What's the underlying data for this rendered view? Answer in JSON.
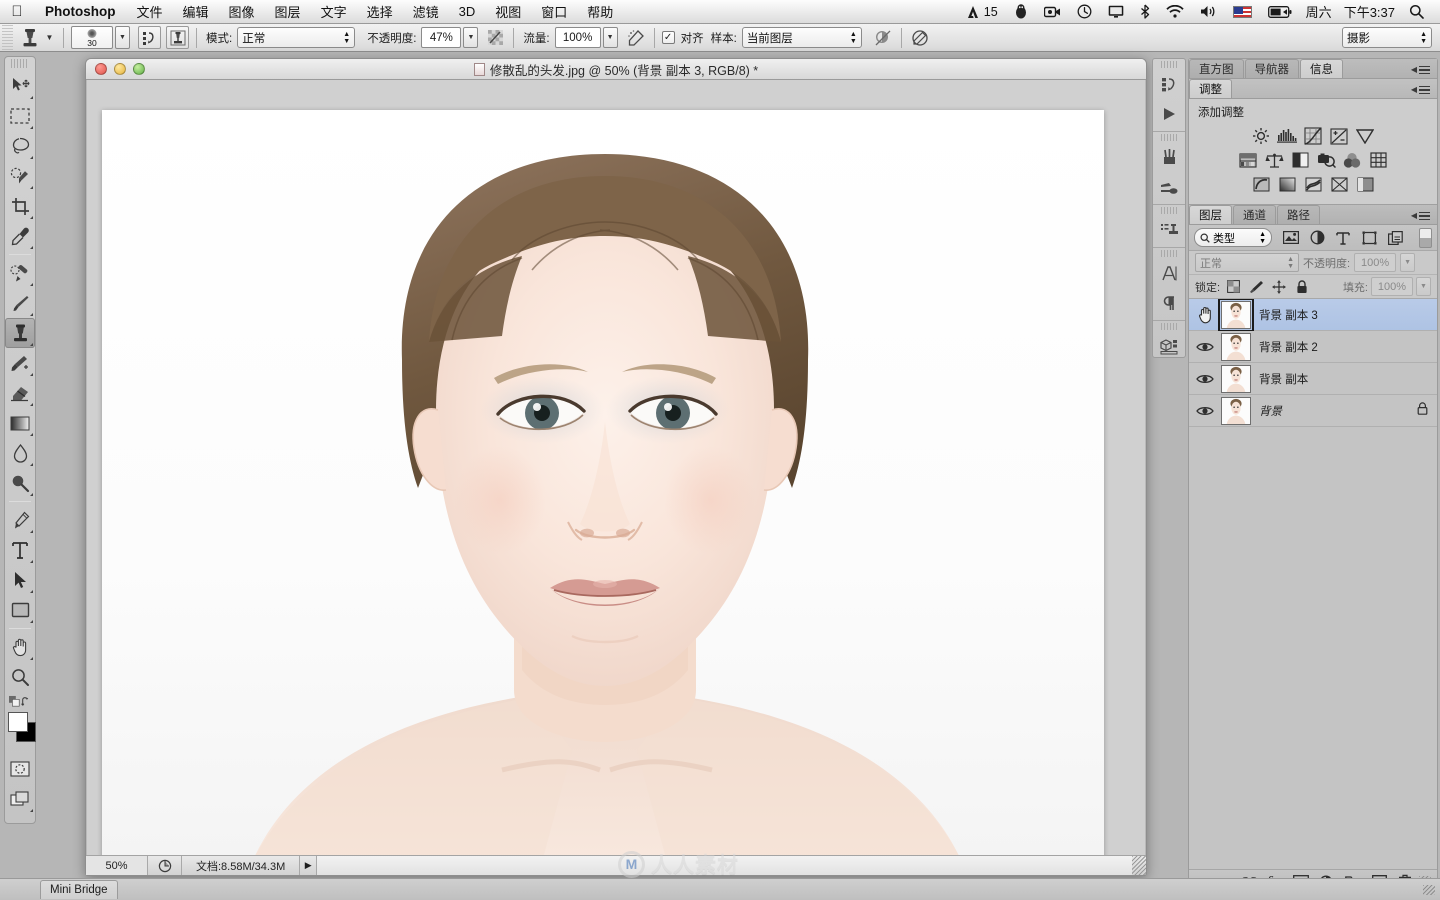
{
  "menubar": {
    "apple_icon": "apple-icon",
    "app_name": "Photoshop",
    "items": [
      "文件",
      "编辑",
      "图像",
      "图层",
      "文字",
      "选择",
      "滤镜",
      "3D",
      "视图",
      "窗口",
      "帮助"
    ],
    "right": {
      "adobe_badge": "15",
      "qq_icon": "penguin-icon",
      "camera_icon": "camera-icon",
      "clock_icon": "history-icon",
      "display_icon": "display-icon",
      "bluetooth_icon": "bluetooth-icon",
      "wifi_icon": "wifi-icon",
      "volume_icon": "volume-icon",
      "flag_icon": "us-flag-icon",
      "battery_icon": "battery-icon",
      "date": "周六",
      "time": "下午3:37",
      "search_icon": "search-icon"
    }
  },
  "options_bar": {
    "tool_icon": "clone-stamp-icon",
    "brush_size": "30",
    "toggle_brush_panel_icon": "brush-panel-icon",
    "toggle_clone_source_icon": "clone-source-icon",
    "mode_label": "模式:",
    "mode_value": "正常",
    "opacity_label": "不透明度:",
    "opacity_value": "47%",
    "opacity_pressure_icon": "pressure-opacity-icon",
    "flow_label": "流量:",
    "flow_value": "100%",
    "airbrush_icon": "airbrush-icon",
    "aligned_label": "对齐",
    "aligned_checked": true,
    "sample_label": "样本:",
    "sample_value": "当前图层",
    "ignore_adjustment_icon": "ignore-adjustment-layers-icon",
    "pressure_size_icon": "pressure-size-icon",
    "workspace_value": "摄影"
  },
  "toolbar": {
    "tools": [
      {
        "name": "move-tool",
        "selected": false
      },
      {
        "name": "marquee-tool",
        "selected": false
      },
      {
        "name": "lasso-tool",
        "selected": false
      },
      {
        "name": "quick-selection-tool",
        "selected": false
      },
      {
        "name": "crop-tool",
        "selected": false
      },
      {
        "name": "eyedropper-tool",
        "selected": false
      },
      {
        "name": "spot-healing-brush-tool",
        "selected": false
      },
      {
        "name": "brush-tool",
        "selected": false
      },
      {
        "name": "clone-stamp-tool",
        "selected": true
      },
      {
        "name": "history-brush-tool",
        "selected": false
      },
      {
        "name": "eraser-tool",
        "selected": false
      },
      {
        "name": "gradient-tool",
        "selected": false
      },
      {
        "name": "blur-tool",
        "selected": false
      },
      {
        "name": "dodge-tool",
        "selected": false
      },
      {
        "name": "pen-tool",
        "selected": false
      },
      {
        "name": "type-tool",
        "selected": false
      },
      {
        "name": "path-selection-tool",
        "selected": false
      },
      {
        "name": "rectangle-tool",
        "selected": false
      },
      {
        "name": "hand-tool",
        "selected": false
      },
      {
        "name": "zoom-tool",
        "selected": false
      }
    ],
    "foreground_color": "#ffffff",
    "background_color": "#000000",
    "quick_mask_icon": "quick-mask-icon",
    "screen_mode_icon": "screen-mode-icon"
  },
  "document": {
    "title": "修散乱的头发.jpg @ 50% (背景 副本 3, RGB/8) *",
    "window_buttons": [
      "close",
      "minimize",
      "zoom"
    ],
    "status": {
      "zoom": "50%",
      "preview_icon": "preview-icon",
      "doc_info": "文档:8.58M/34.3M",
      "expand_icon": "expand-arrow-icon"
    }
  },
  "icon_strip": {
    "groups": [
      [
        "history-panel-icon",
        "actions-play-icon"
      ],
      [
        "brushes-panel-icon",
        "tool-presets-icon"
      ],
      [
        "clone-source-panel-icon"
      ],
      [
        "character-panel-icon",
        "paragraph-panel-icon"
      ],
      [
        "3d-panel-icon"
      ]
    ]
  },
  "right_panel": {
    "top_tabs": [
      {
        "label": "直方图",
        "active": false
      },
      {
        "label": "导航器",
        "active": false
      },
      {
        "label": "信息",
        "active": true
      }
    ],
    "adjustments": {
      "tab_label": "调整",
      "title": "添加调整",
      "row1": [
        "brightness-contrast-icon",
        "levels-icon",
        "curves-icon",
        "exposure-icon",
        "vibrance-icon"
      ],
      "row2": [
        "hue-saturation-icon",
        "color-balance-icon",
        "black-white-icon",
        "photo-filter-icon",
        "channel-mixer-icon",
        "color-lookup-icon"
      ],
      "row3": [
        "invert-icon",
        "posterize-icon",
        "threshold-icon",
        "gradient-map-icon",
        "selective-color-icon"
      ]
    },
    "layers": {
      "tabs": [
        {
          "label": "图层",
          "active": true
        },
        {
          "label": "通道",
          "active": false
        },
        {
          "label": "路径",
          "active": false
        }
      ],
      "filter_label": "类型",
      "filter_icon": "search-icon",
      "filter_type_icons": [
        "pixel-layers-icon",
        "adjustment-layers-icon",
        "type-layers-icon",
        "shape-layers-icon",
        "smart-object-icon"
      ],
      "filter_toggle_icon": "filter-toggle-icon",
      "blend_mode": "正常",
      "opacity_label": "不透明度:",
      "opacity_value": "100%",
      "lock_label": "锁定:",
      "lock_icons": [
        "lock-transparency-icon",
        "lock-image-icon",
        "lock-position-icon",
        "lock-all-icon"
      ],
      "fill_label": "填充:",
      "fill_value": "100%",
      "rows": [
        {
          "name": "背景 副本 3",
          "visible": false,
          "selected": true,
          "locked": false,
          "cursor_icon": "hand-cursor-icon"
        },
        {
          "name": "背景 副本 2",
          "visible": true,
          "selected": false,
          "locked": false
        },
        {
          "name": "背景 副本",
          "visible": true,
          "selected": false,
          "locked": false
        },
        {
          "name": "背景",
          "visible": true,
          "selected": false,
          "locked": true
        }
      ],
      "footer_icons": [
        "link-layers-icon",
        "layer-style-fx-icon",
        "add-layer-mask-icon",
        "new-adjustment-layer-icon",
        "new-group-icon",
        "new-layer-icon",
        "delete-layer-icon"
      ]
    }
  },
  "bottom_bar": {
    "mini_bridge_label": "Mini Bridge"
  },
  "watermark": {
    "logo": "M",
    "text": "人人素材"
  },
  "colors": {
    "selection_blue": "#aec3e4",
    "chrome_gray": "#c9c9c9",
    "panel_gray": "#cdcdcd"
  }
}
